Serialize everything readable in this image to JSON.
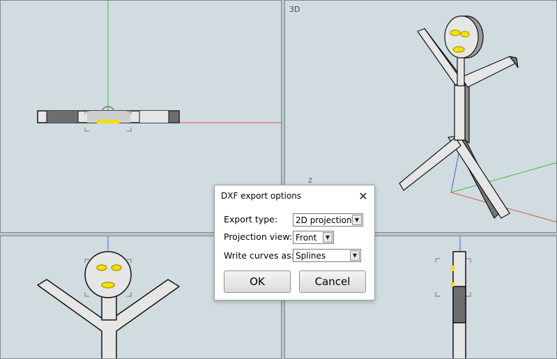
{
  "viewports": {
    "three_d_label": "3D",
    "axis_z_label": "Z"
  },
  "dialog": {
    "title": "DXF export options",
    "close_icon": "close-icon",
    "fields": [
      {
        "label": "Export type:",
        "value": "2D projection"
      },
      {
        "label": "Projection view:",
        "value": "Front"
      },
      {
        "label": "Write curves as:",
        "value": "Splines"
      }
    ],
    "ok_label": "OK",
    "cancel_label": "Cancel"
  },
  "colors": {
    "viewport_bg": "#d0dcdf",
    "axis_x": "#e05050",
    "axis_y": "#40c040",
    "axis_z": "#4060e0",
    "figure_fill": "#e6e6e6",
    "figure_dark": "#7a7a7a",
    "highlight": "#f5e000"
  }
}
